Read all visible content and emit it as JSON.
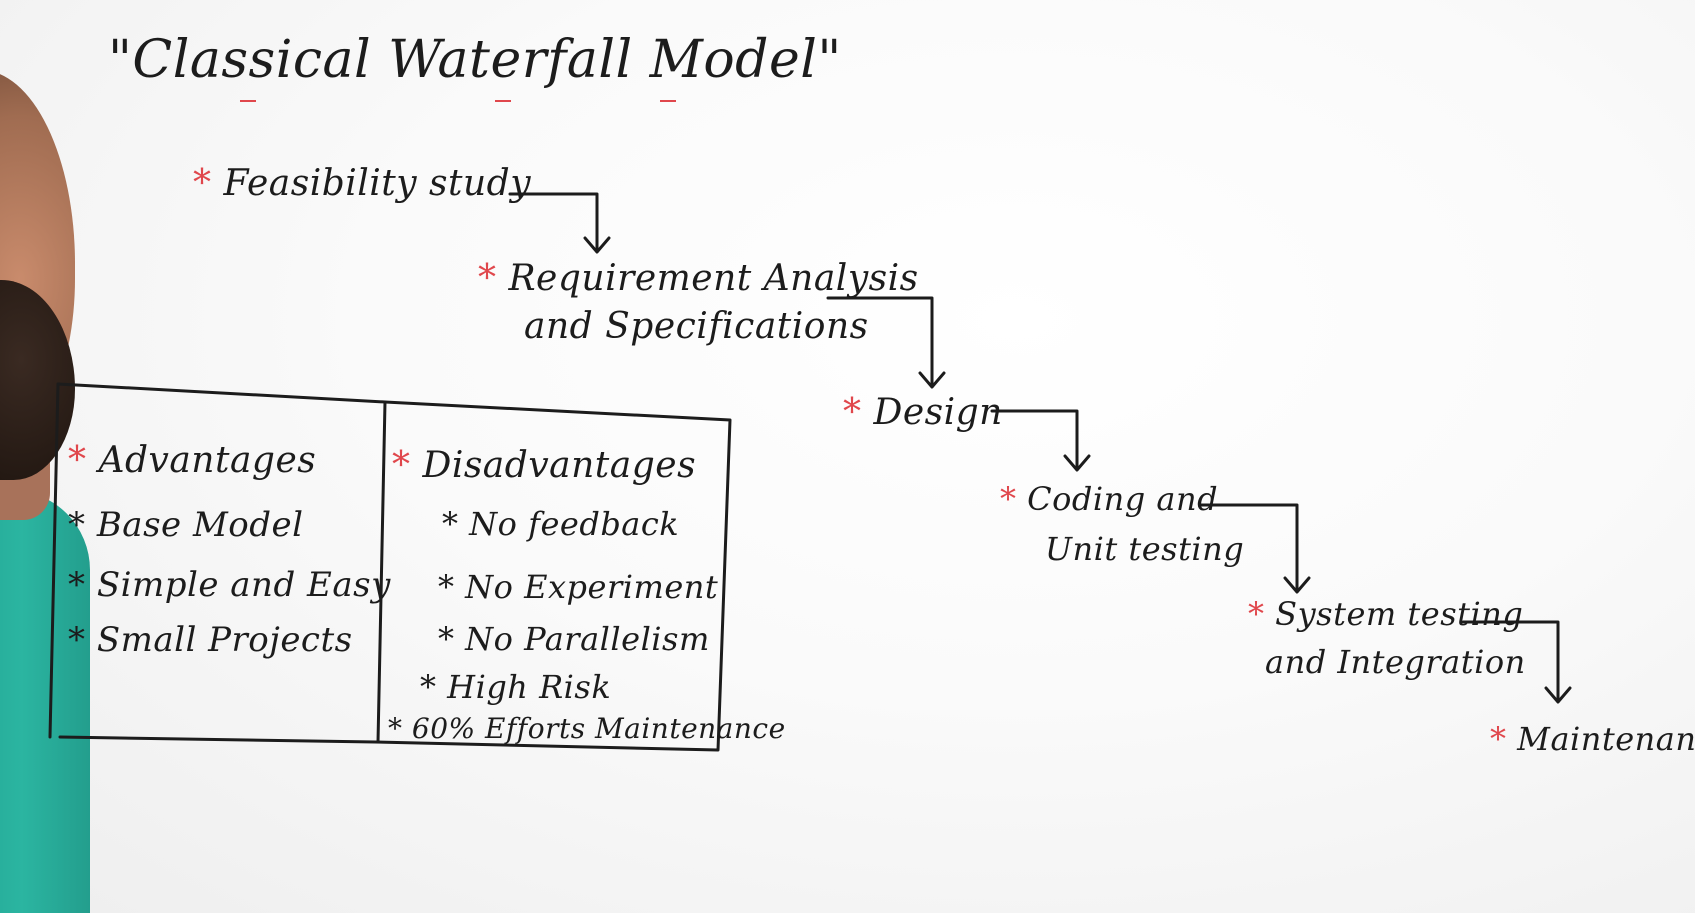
{
  "title": "\"Classical Waterfall Model\"",
  "bullet_star": "*",
  "phases": [
    {
      "lines": [
        "Feasibility study"
      ]
    },
    {
      "lines": [
        "Requirement Analysis",
        "and Specifications"
      ]
    },
    {
      "lines": [
        "Design"
      ]
    },
    {
      "lines": [
        "Coding and",
        "Unit testing"
      ]
    },
    {
      "lines": [
        "System testing",
        "and Integration"
      ]
    },
    {
      "lines": [
        "Maintenance"
      ]
    }
  ],
  "advantages": {
    "heading": "Advantages",
    "items": [
      "Base Model",
      "Simple and Easy",
      "Small Projects"
    ]
  },
  "disadvantages": {
    "heading": "Disadvantages",
    "items": [
      "No feedback",
      "No Experiment",
      "No Parallelism",
      "High Risk",
      "60% Efforts Maintenance"
    ]
  },
  "colors": {
    "board": "#ffffff",
    "ink": "#1c1c1c",
    "accent_red": "#e0474c",
    "shirt": "#2bb5a1"
  }
}
